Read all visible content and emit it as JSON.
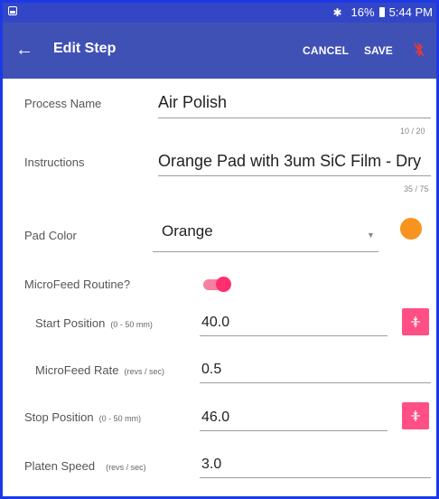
{
  "status_bar": {
    "battery_percent": "16%",
    "time": "5:44 PM"
  },
  "app_bar": {
    "title": "Edit Step",
    "cancel_label": "CANCEL",
    "save_label": "SAVE"
  },
  "form": {
    "process_name": {
      "label": "Process Name",
      "value": "Air Polish",
      "counter": "10 / 20"
    },
    "instructions": {
      "label": "Instructions",
      "value": "Orange Pad with 3um SiC Film - Dry",
      "counter": "35 / 75"
    },
    "pad_color": {
      "label": "Pad Color",
      "value": "Orange",
      "swatch_color": "#f7931e"
    },
    "microfeed": {
      "label": "MicroFeed Routine?",
      "enabled": true
    },
    "start_position": {
      "label": "Start Position",
      "unit": "(0 - 50 mm)",
      "value": "40.0"
    },
    "microfeed_rate": {
      "label": "MicroFeed Rate",
      "unit": "(revs / sec)",
      "value": "0.5"
    },
    "stop_position": {
      "label": "Stop Position",
      "unit": "(0 - 50 mm)",
      "value": "46.0"
    },
    "platen_speed": {
      "label": "Platen Speed",
      "unit": "(revs / sec)",
      "value": "3.0"
    }
  },
  "colors": {
    "app_bar": "#3f51b5",
    "status_bar": "#3347c6",
    "accent": "#ff4f85",
    "pad_swatch": "#f7931e"
  }
}
